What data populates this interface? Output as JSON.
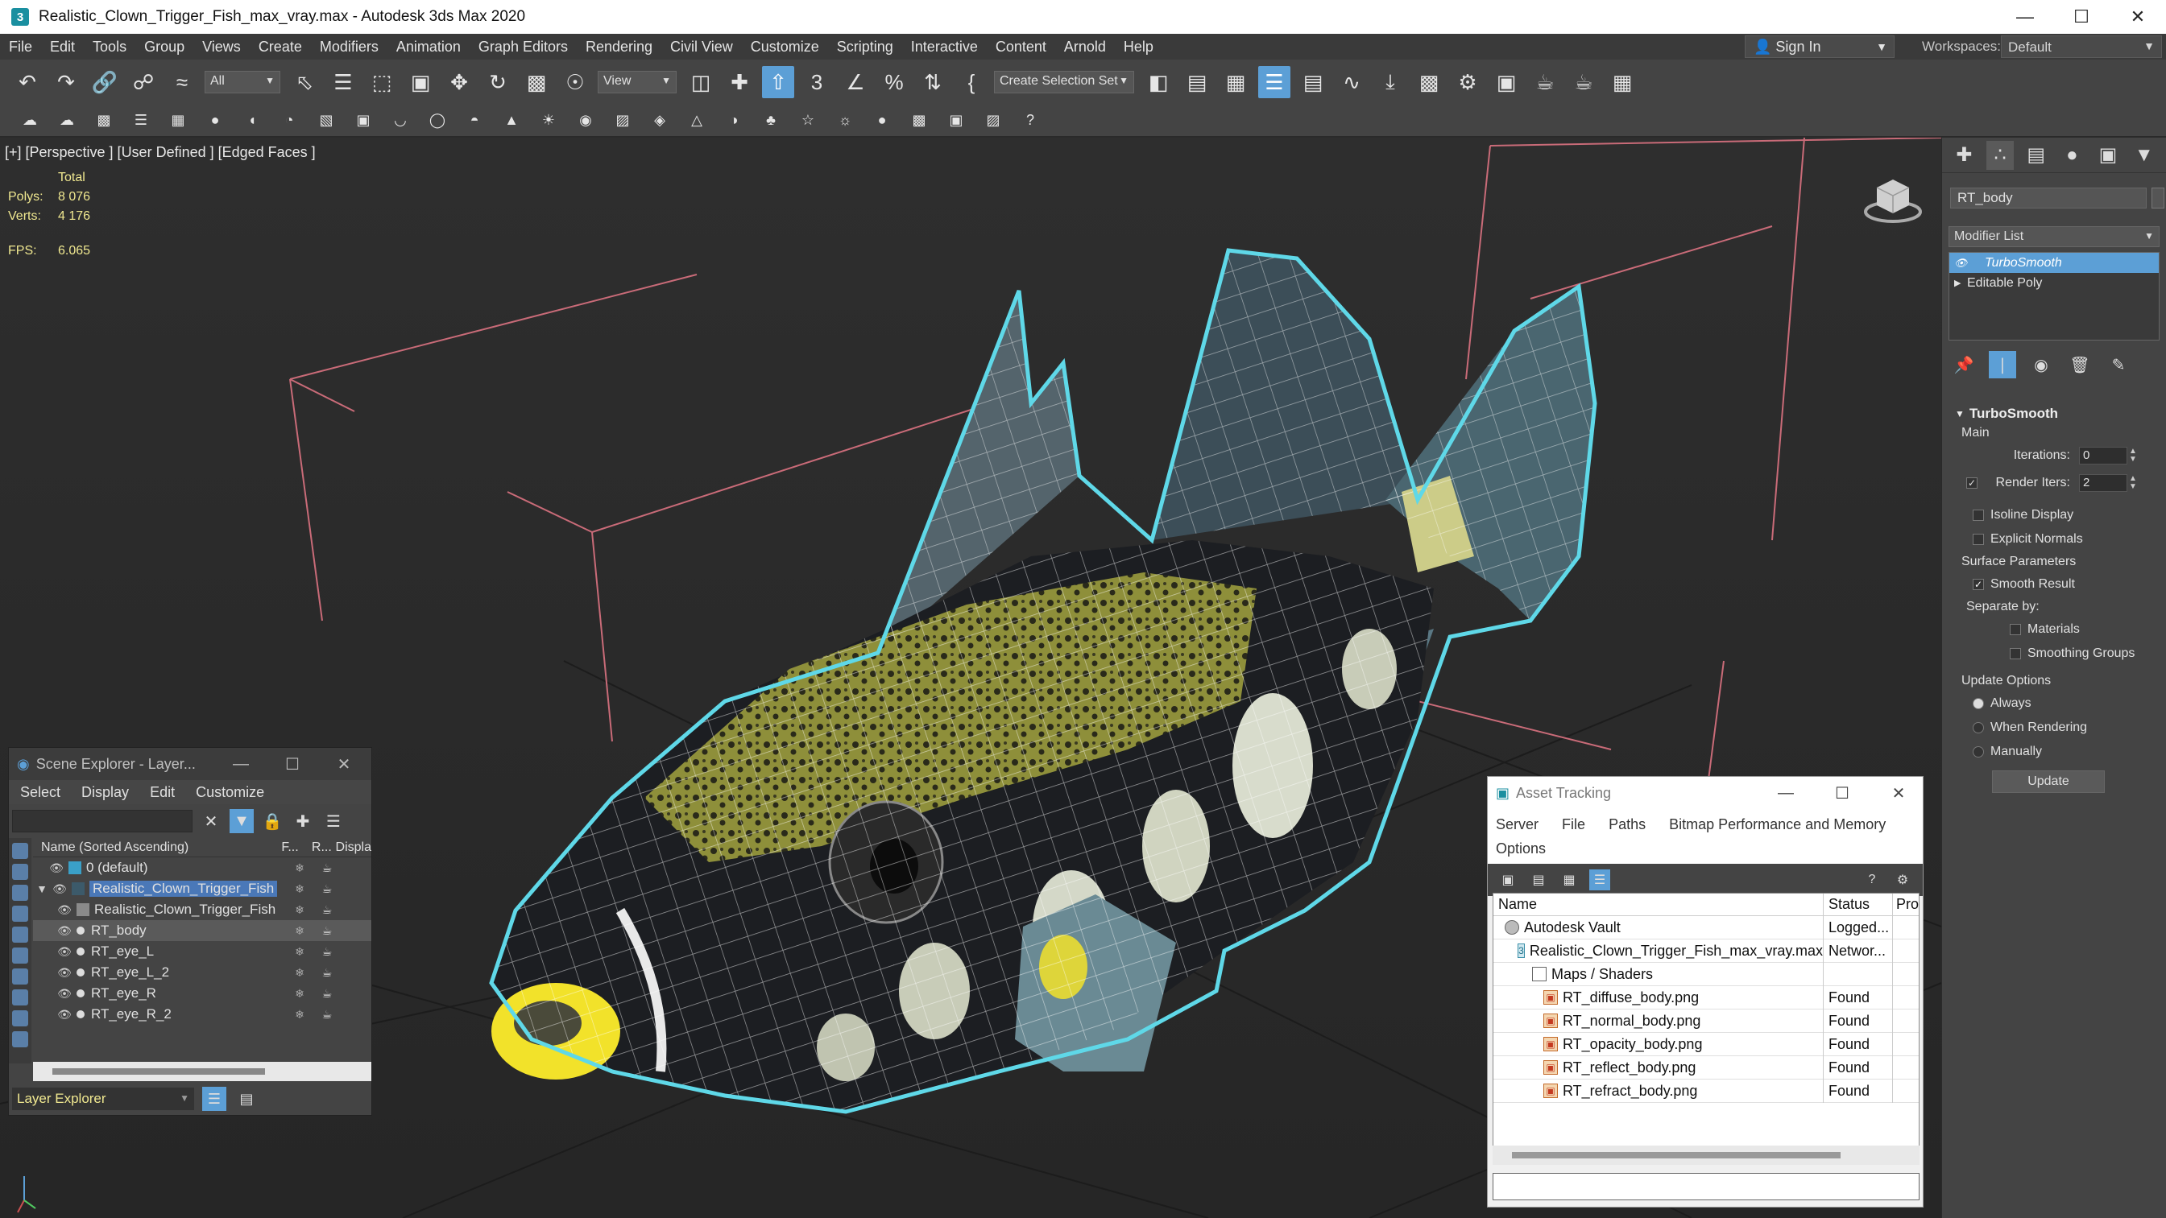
{
  "window": {
    "title": "Realistic_Clown_Trigger_Fish_max_vray.max - Autodesk 3ds Max 2020",
    "app_icon": "3"
  },
  "menu": {
    "items": [
      "File",
      "Edit",
      "Tools",
      "Group",
      "Views",
      "Create",
      "Modifiers",
      "Animation",
      "Graph Editors",
      "Rendering",
      "Civil View",
      "Customize",
      "Scripting",
      "Interactive",
      "Content",
      "Arnold",
      "Help"
    ],
    "sign_in": "Sign In",
    "workspaces_label": "Workspaces:",
    "workspace": "Default"
  },
  "toolbar": {
    "selection_filter": "All",
    "ref_coord": "View",
    "named_selection": "Create Selection Set"
  },
  "viewport": {
    "label": "[+] [Perspective ] [User Defined ] [Edged Faces ]",
    "stats": {
      "total_label": "Total",
      "polys_label": "Polys:",
      "polys": "8 076",
      "verts_label": "Verts:",
      "verts": "4 176",
      "fps_label": "FPS:",
      "fps": "6.065"
    }
  },
  "scene_explorer": {
    "title": "Scene Explorer - Layer...",
    "menus": [
      "Select",
      "Display",
      "Edit",
      "Customize"
    ],
    "columns": {
      "name": "Name (Sorted Ascending)",
      "frozen": "F...",
      "render": "R...",
      "display": "Displa"
    },
    "rows": [
      {
        "name": "0 (default)",
        "type": "layer",
        "indent": 0
      },
      {
        "name": "Realistic_Clown_Trigger_Fish",
        "type": "layer",
        "indent": 0,
        "highlight": true
      },
      {
        "name": "Realistic_Clown_Trigger_Fish",
        "type": "group",
        "indent": 1
      },
      {
        "name": "RT_body",
        "type": "object",
        "indent": 1,
        "selected": true
      },
      {
        "name": "RT_eye_L",
        "type": "object",
        "indent": 1
      },
      {
        "name": "RT_eye_L_2",
        "type": "object",
        "indent": 1
      },
      {
        "name": "RT_eye_R",
        "type": "object",
        "indent": 1
      },
      {
        "name": "RT_eye_R_2",
        "type": "object",
        "indent": 1
      }
    ],
    "layer_explorer": "Layer Explorer"
  },
  "asset_tracking": {
    "title": "Asset Tracking",
    "menu_line1": [
      "Server",
      "File",
      "Paths",
      "Bitmap Performance and Memory"
    ],
    "menu_line2": [
      "Options"
    ],
    "columns": {
      "name": "Name",
      "status": "Status",
      "pro": "Pro"
    },
    "rows": [
      {
        "name": "Autodesk Vault",
        "status": "Logged...",
        "icon": "vault",
        "indent": 14
      },
      {
        "name": "Realistic_Clown_Trigger_Fish_max_vray.max",
        "status": "Networ...",
        "icon": "max",
        "indent": 30
      },
      {
        "name": "Maps / Shaders",
        "status": "",
        "icon": "folder",
        "indent": 48
      },
      {
        "name": "RT_diffuse_body.png",
        "status": "Found",
        "icon": "img",
        "indent": 62
      },
      {
        "name": "RT_normal_body.png",
        "status": "Found",
        "icon": "img",
        "indent": 62
      },
      {
        "name": "RT_opacity_body.png",
        "status": "Found",
        "icon": "img",
        "indent": 62
      },
      {
        "name": "RT_reflect_body.png",
        "status": "Found",
        "icon": "img",
        "indent": 62
      },
      {
        "name": "RT_refract_body.png",
        "status": "Found",
        "icon": "img",
        "indent": 62
      }
    ]
  },
  "command_panel": {
    "object_name": "RT_body",
    "modifier_list": "Modifier List",
    "stack": [
      {
        "name": "TurboSmooth",
        "selected": true
      },
      {
        "name": "Editable Poly",
        "selected": false
      }
    ],
    "turbosmooth": {
      "title": "TurboSmooth",
      "main": "Main",
      "iterations_label": "Iterations:",
      "iterations": "0",
      "render_iters_label": "Render Iters:",
      "render_iters": "2",
      "isoline_display": "Isoline Display",
      "explicit_normals": "Explicit Normals",
      "surface_parameters": "Surface Parameters",
      "smooth_result": "Smooth Result",
      "separate_by": "Separate by:",
      "materials": "Materials",
      "smoothing_groups": "Smoothing Groups",
      "update_options": "Update Options",
      "always": "Always",
      "when_rendering": "When Rendering",
      "manually": "Manually",
      "update": "Update"
    }
  },
  "colors": {
    "accent": "#5c9fd6",
    "selection_outline": "#5fd8e8",
    "stats_text": "#f0e890",
    "grid": "#c96b78"
  }
}
